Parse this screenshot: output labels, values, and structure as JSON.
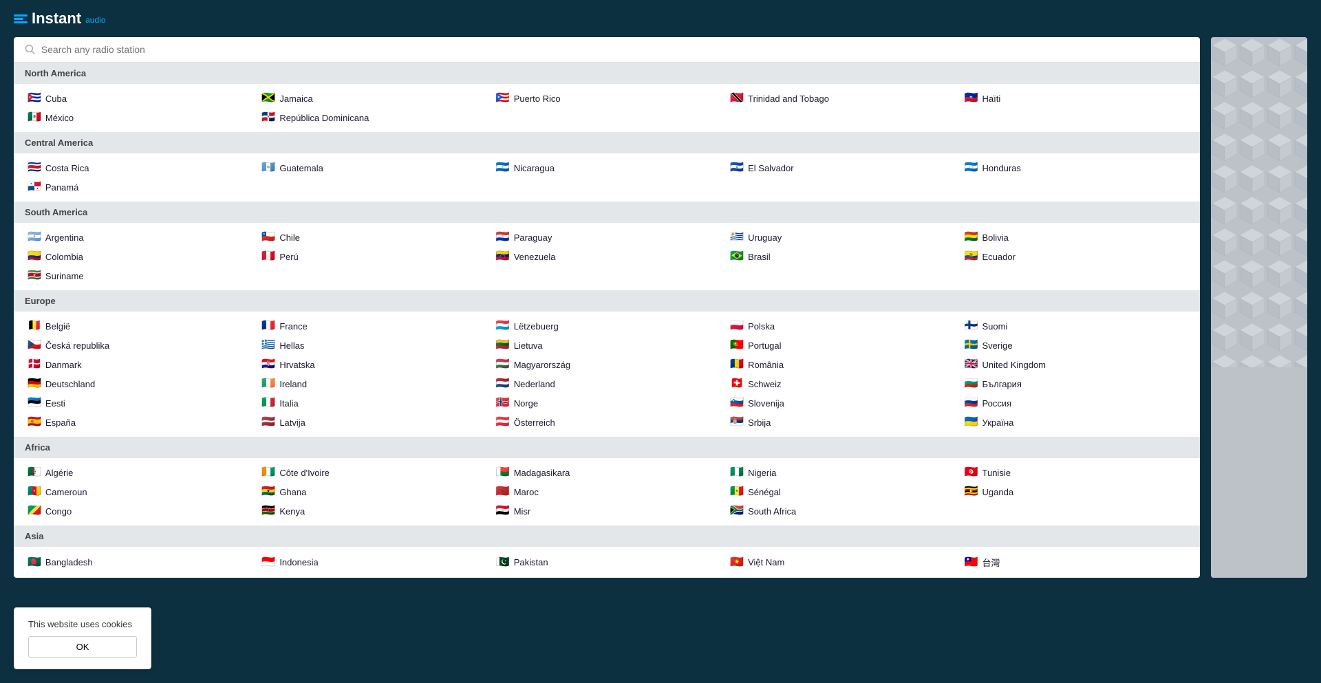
{
  "app": {
    "logo_instant": "Instant",
    "logo_audio": "audio",
    "search_placeholder": "Search any radio station"
  },
  "cookie": {
    "message": "This website uses cookies",
    "ok_label": "OK"
  },
  "regions": [
    {
      "id": "north-america",
      "label": "North America",
      "countries": [
        {
          "flag": "🇨🇺",
          "name": "Cuba"
        },
        {
          "flag": "🇯🇲",
          "name": "Jamaica"
        },
        {
          "flag": "🇵🇷",
          "name": "Puerto Rico"
        },
        {
          "flag": "🇹🇹",
          "name": "Trinidad and Tobago"
        },
        {
          "flag": "🇭🇹",
          "name": "Haïti"
        },
        {
          "flag": "🇲🇽",
          "name": "México"
        },
        {
          "flag": "🇩🇴",
          "name": "República Dominicana"
        }
      ]
    },
    {
      "id": "central-america",
      "label": "Central America",
      "countries": [
        {
          "flag": "🇨🇷",
          "name": "Costa Rica"
        },
        {
          "flag": "🇬🇹",
          "name": "Guatemala"
        },
        {
          "flag": "🇳🇮",
          "name": "Nicaragua"
        },
        {
          "flag": "🇸🇻",
          "name": "El Salvador"
        },
        {
          "flag": "🇭🇳",
          "name": "Honduras"
        },
        {
          "flag": "🇵🇦",
          "name": "Panamá"
        }
      ]
    },
    {
      "id": "south-america",
      "label": "South America",
      "countries": [
        {
          "flag": "🇦🇷",
          "name": "Argentina"
        },
        {
          "flag": "🇨🇱",
          "name": "Chile"
        },
        {
          "flag": "🇵🇾",
          "name": "Paraguay"
        },
        {
          "flag": "🇺🇾",
          "name": "Uruguay"
        },
        {
          "flag": "🇧🇴",
          "name": "Bolivia"
        },
        {
          "flag": "🇨🇴",
          "name": "Colombia"
        },
        {
          "flag": "🇵🇪",
          "name": "Perú"
        },
        {
          "flag": "🇻🇪",
          "name": "Venezuela"
        },
        {
          "flag": "🇧🇷",
          "name": "Brasil"
        },
        {
          "flag": "🇪🇨",
          "name": "Ecuador"
        },
        {
          "flag": "🇸🇷",
          "name": "Suriname"
        }
      ]
    },
    {
      "id": "europe",
      "label": "Europe",
      "countries": [
        {
          "flag": "🇧🇪",
          "name": "België"
        },
        {
          "flag": "🇫🇷",
          "name": "France"
        },
        {
          "flag": "🇱🇺",
          "name": "Lëtzebuerg"
        },
        {
          "flag": "🇵🇱",
          "name": "Polska"
        },
        {
          "flag": "🇫🇮",
          "name": "Suomi"
        },
        {
          "flag": "🇨🇿",
          "name": "Česká republika"
        },
        {
          "flag": "🇬🇷",
          "name": "Hellas"
        },
        {
          "flag": "🇱🇹",
          "name": "Lietuva"
        },
        {
          "flag": "🇵🇹",
          "name": "Portugal"
        },
        {
          "flag": "🇸🇪",
          "name": "Sverige"
        },
        {
          "flag": "🇩🇰",
          "name": "Danmark"
        },
        {
          "flag": "🇭🇷",
          "name": "Hrvatska"
        },
        {
          "flag": "🇭🇺",
          "name": "Magyarország"
        },
        {
          "flag": "🇷🇴",
          "name": "România"
        },
        {
          "flag": "🇬🇧",
          "name": "United Kingdom"
        },
        {
          "flag": "🇩🇪",
          "name": "Deutschland"
        },
        {
          "flag": "🇮🇪",
          "name": "Ireland"
        },
        {
          "flag": "🇳🇱",
          "name": "Nederland"
        },
        {
          "flag": "🇨🇭",
          "name": "Schweiz"
        },
        {
          "flag": "🇧🇬",
          "name": "България"
        },
        {
          "flag": "🇪🇪",
          "name": "Eesti"
        },
        {
          "flag": "🇮🇹",
          "name": "Italia"
        },
        {
          "flag": "🇳🇴",
          "name": "Norge"
        },
        {
          "flag": "🇸🇮",
          "name": "Slovenija"
        },
        {
          "flag": "🇷🇺",
          "name": "Россия"
        },
        {
          "flag": "🇪🇸",
          "name": "España"
        },
        {
          "flag": "🇱🇻",
          "name": "Latvija"
        },
        {
          "flag": "🇦🇹",
          "name": "Österreich"
        },
        {
          "flag": "🇷🇸",
          "name": "Srbija"
        },
        {
          "flag": "🇺🇦",
          "name": "Україна"
        }
      ]
    },
    {
      "id": "africa",
      "label": "Africa",
      "countries": [
        {
          "flag": "🇩🇿",
          "name": "Algérie"
        },
        {
          "flag": "🇨🇮",
          "name": "Côte d'Ivoire"
        },
        {
          "flag": "🇲🇬",
          "name": "Madagasikara"
        },
        {
          "flag": "🇳🇬",
          "name": "Nigeria"
        },
        {
          "flag": "🇹🇳",
          "name": "Tunisie"
        },
        {
          "flag": "🇨🇲",
          "name": "Cameroun"
        },
        {
          "flag": "🇬🇭",
          "name": "Ghana"
        },
        {
          "flag": "🇲🇦",
          "name": "Maroc"
        },
        {
          "flag": "🇸🇳",
          "name": "Sénégal"
        },
        {
          "flag": "🇺🇬",
          "name": "Uganda"
        },
        {
          "flag": "🇨🇬",
          "name": "Congo"
        },
        {
          "flag": "🇰🇪",
          "name": "Kenya"
        },
        {
          "flag": "🇪🇬",
          "name": "Misr"
        },
        {
          "flag": "🇿🇦",
          "name": "South Africa"
        }
      ]
    },
    {
      "id": "asia",
      "label": "Asia",
      "countries": [
        {
          "flag": "🇧🇩",
          "name": "Bangladesh"
        },
        {
          "flag": "🇮🇩",
          "name": "Indonesia"
        },
        {
          "flag": "🇵🇰",
          "name": "Pakistan"
        },
        {
          "flag": "🇻🇳",
          "name": "Việt Nam"
        },
        {
          "flag": "🇹🇼",
          "name": "台灣"
        }
      ]
    }
  ]
}
